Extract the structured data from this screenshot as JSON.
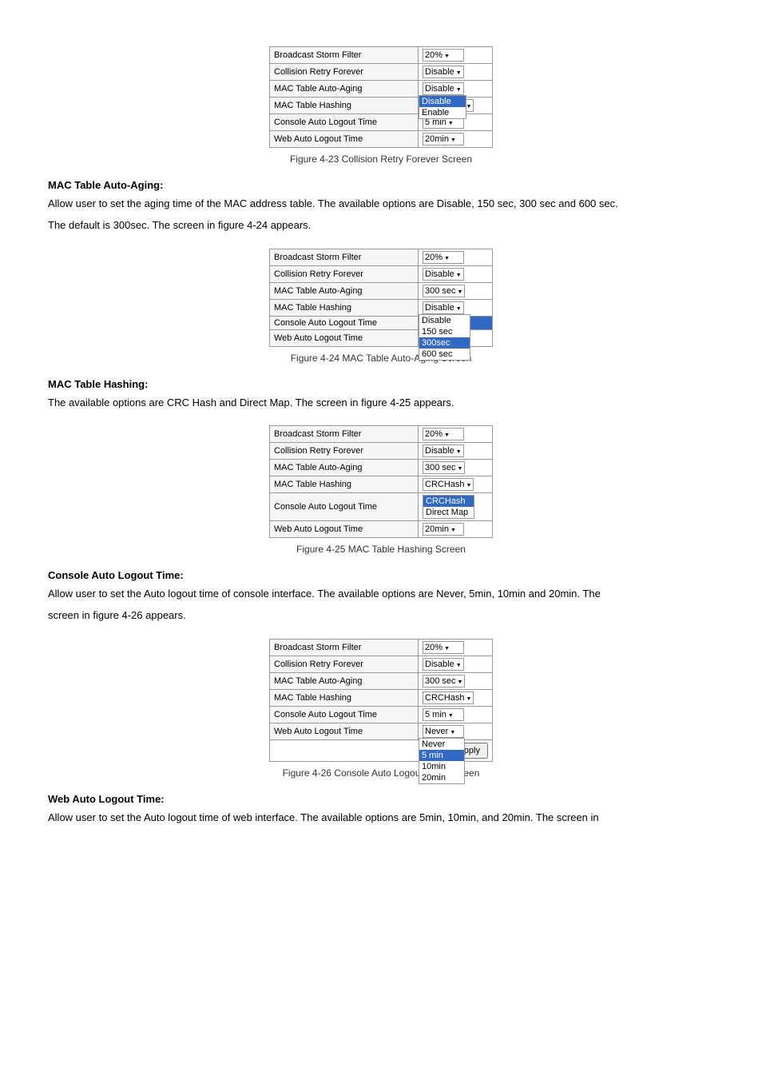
{
  "figures": {
    "fig23": {
      "caption": "Figure 4-23 Collision Retry Forever Screen",
      "rows": [
        {
          "label": "Broadcast Storm Filter",
          "value": "20%",
          "type": "dropdown"
        },
        {
          "label": "Collision Retry Forever",
          "value": "Disable",
          "type": "dropdown"
        },
        {
          "label": "MAC Table Auto-Aging",
          "value": "Disable\nEnable",
          "type": "dropdown-open"
        },
        {
          "label": "MAC Table Hashing",
          "value": "CRCHash",
          "type": "dropdown"
        },
        {
          "label": "Console Auto Logout Time",
          "value": "5 min",
          "type": "dropdown"
        },
        {
          "label": "Web Auto Logout Time",
          "value": "20min",
          "type": "dropdown"
        }
      ]
    },
    "fig24": {
      "caption": "Figure 4-24 MAC Table Auto-Aging Screen",
      "rows": [
        {
          "label": "Broadcast Storm Filter",
          "value": "20%",
          "type": "dropdown"
        },
        {
          "label": "Collision Retry Forever",
          "value": "Disable",
          "type": "dropdown"
        },
        {
          "label": "MAC Table Auto-Aging",
          "value": "300 sec",
          "type": "dropdown"
        },
        {
          "label": "MAC Table Hashing",
          "value": "Disable\n150 sec\n300sec\n600 sec",
          "type": "dropdown-open-mac"
        },
        {
          "label": "Console Auto Logout Time",
          "value": "300sec",
          "type": "dropdown-highlighted"
        },
        {
          "label": "Web Auto Logout Time",
          "value": "20min",
          "type": "dropdown"
        }
      ]
    },
    "fig25": {
      "caption": "Figure 4-25 MAC Table Hashing Screen",
      "rows": [
        {
          "label": "Broadcast Storm Filter",
          "value": "20%",
          "type": "dropdown"
        },
        {
          "label": "Collision Retry Forever",
          "value": "Disable",
          "type": "dropdown"
        },
        {
          "label": "MAC Table Auto-Aging",
          "value": "300 sec",
          "type": "dropdown"
        },
        {
          "label": "MAC Table Hashing",
          "value": "CRCHash",
          "type": "dropdown"
        },
        {
          "label": "Console Auto Logout Time",
          "value": "CRCHash\nDirect Map",
          "type": "dropdown-open-hash"
        },
        {
          "label": "Web Auto Logout Time",
          "value": "20min",
          "type": "dropdown"
        }
      ]
    },
    "fig26": {
      "caption": "Figure 4-26 Console Auto Logout Time Screen",
      "rows": [
        {
          "label": "Broadcast Storm Filter",
          "value": "20%",
          "type": "dropdown"
        },
        {
          "label": "Collision Retry Forever",
          "value": "Disable",
          "type": "dropdown"
        },
        {
          "label": "MAC Table Auto-Aging",
          "value": "300 sec",
          "type": "dropdown"
        },
        {
          "label": "MAC Table Hashing",
          "value": "CRCHash",
          "type": "dropdown"
        },
        {
          "label": "Console Auto Logout Time",
          "value": "5 min",
          "type": "dropdown"
        },
        {
          "label": "Web Auto Logout Time",
          "value": "Never\n5 min\n10min\n20min",
          "type": "dropdown-open-console"
        }
      ],
      "has_apply": true
    }
  },
  "sections": {
    "mac_auto_aging": {
      "heading": "MAC Table Auto-Aging:",
      "body1": "Allow user to set the aging time of the MAC address table. The available options are Disable, 150 sec, 300 sec and 600 sec.",
      "body2": "The default is 300sec. The screen in figure 4-24 appears."
    },
    "mac_hashing": {
      "heading": "MAC Table Hashing:",
      "body1": "The available options are CRC Hash and Direct Map. The screen in figure 4-25 appears."
    },
    "console_logout": {
      "heading": "Console Auto Logout Time:",
      "body1": "Allow user to set the Auto logout time of console interface. The available options are Never, 5min, 10min and 20min. The",
      "body2": "screen in figure 4-26 appears."
    },
    "web_logout": {
      "heading": "Web Auto Logout Time:",
      "body1": "Allow user to set the Auto logout time of web interface. The available options are 5min, 10min, and 20min. The screen in"
    }
  }
}
